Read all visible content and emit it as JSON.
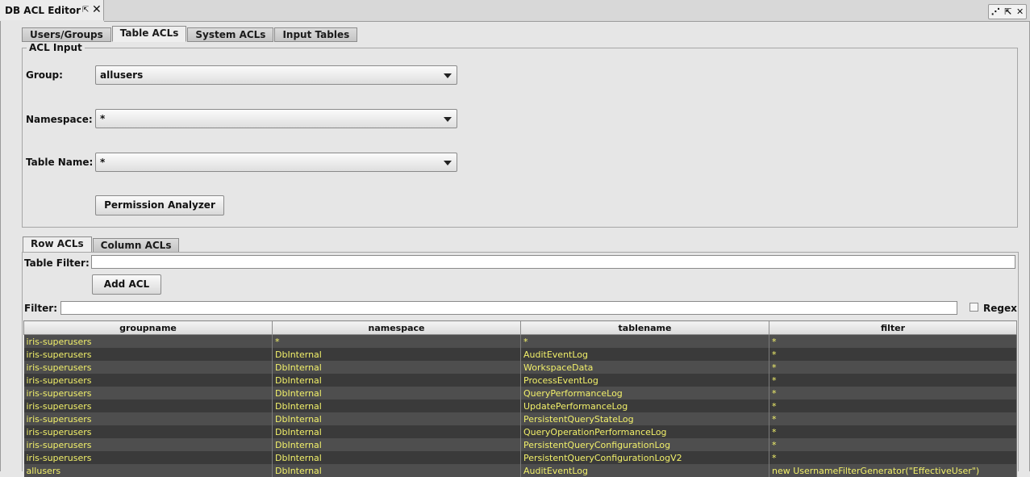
{
  "window": {
    "title": "DB ACL Editor",
    "pin_glyph": "⇱",
    "close_glyph": "✕",
    "controls": [
      "⋰",
      "⇱",
      "✕"
    ]
  },
  "main_tabs": [
    {
      "label": "Users/Groups",
      "active": false
    },
    {
      "label": "Table ACLs",
      "active": true
    },
    {
      "label": "System ACLs",
      "active": false
    },
    {
      "label": "Input Tables",
      "active": false
    }
  ],
  "acl_input": {
    "legend": "ACL Input",
    "group_label": "Group:",
    "group_value": "allusers",
    "namespace_label": "Namespace:",
    "namespace_value": "*",
    "table_name_label": "Table Name:",
    "table_name_value": "*",
    "permission_button": "Permission Analyzer"
  },
  "sub_tabs": [
    {
      "label": "Row ACLs",
      "active": true
    },
    {
      "label": "Column ACLs",
      "active": false
    }
  ],
  "row_acls": {
    "table_filter_label": "Table Filter:",
    "table_filter_value": "",
    "add_button": "Add ACL",
    "filter_label": "Filter:",
    "filter_value": "",
    "regex_label": "Regex",
    "regex_checked": false
  },
  "table": {
    "columns": [
      "groupname",
      "namespace",
      "tablename",
      "filter"
    ],
    "rows": [
      [
        "iris-superusers",
        "*",
        "*",
        "*"
      ],
      [
        "iris-superusers",
        "DbInternal",
        "AuditEventLog",
        "*"
      ],
      [
        "iris-superusers",
        "DbInternal",
        "WorkspaceData",
        "*"
      ],
      [
        "iris-superusers",
        "DbInternal",
        "ProcessEventLog",
        "*"
      ],
      [
        "iris-superusers",
        "DbInternal",
        "QueryPerformanceLog",
        "*"
      ],
      [
        "iris-superusers",
        "DbInternal",
        "UpdatePerformanceLog",
        "*"
      ],
      [
        "iris-superusers",
        "DbInternal",
        "PersistentQueryStateLog",
        "*"
      ],
      [
        "iris-superusers",
        "DbInternal",
        "QueryOperationPerformanceLog",
        "*"
      ],
      [
        "iris-superusers",
        "DbInternal",
        "PersistentQueryConfigurationLog",
        "*"
      ],
      [
        "iris-superusers",
        "DbInternal",
        "PersistentQueryConfigurationLogV2",
        "*"
      ],
      [
        "allusers",
        "DbInternal",
        "AuditEventLog",
        "new UsernameFilterGenerator(\"EffectiveUser\")"
      ]
    ]
  },
  "colors": {
    "cell_text": "#f2f06a",
    "row_odd": "#4e4e4e",
    "row_even": "#3a3a3a",
    "background": "#e6e6e6"
  }
}
